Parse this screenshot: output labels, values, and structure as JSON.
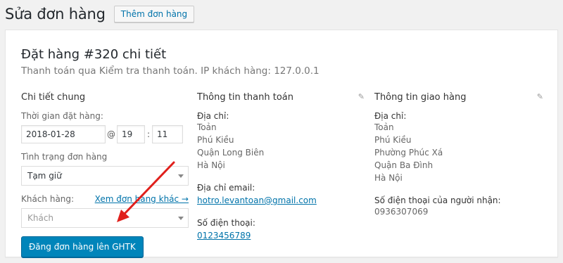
{
  "header": {
    "title": "Sửa đơn hàng",
    "add_button": "Thêm đơn hàng"
  },
  "order": {
    "title": "Đặt hàng #320 chi tiết",
    "subtitle": "Thanh toán qua Kiểm tra thanh toán. IP khách hàng: 127.0.0.1"
  },
  "general": {
    "heading": "Chi tiết chung",
    "date_label": "Thời gian đặt hàng:",
    "date": "2018-01-28",
    "at": "@",
    "hour": "19",
    "colon": ":",
    "minute": "11",
    "status_label": "Tình trạng đơn hàng",
    "status": "Tạm giữ",
    "customer_label": "Khách hàng:",
    "customer_link": "Xem đơn hàng khác →",
    "customer_placeholder": "Khách",
    "ship_button": "Đăng đơn hàng lên GHTK"
  },
  "billing": {
    "heading": "Thông tin thanh toán",
    "address_label": "Địa chỉ:",
    "address": [
      "Toản",
      "Phú Kiều",
      "Quận Long Biên",
      "Hà Nội"
    ],
    "email_label": "Địa chỉ email:",
    "email": "hotro.levantoan@gmail.com",
    "phone_label": "Số điện thoại:",
    "phone": "0123456789"
  },
  "shipping": {
    "heading": "Thông tin giao hàng",
    "address_label": "Địa chỉ:",
    "address": [
      "Toản",
      "Phú Kiều",
      "Phường Phúc Xá",
      "Quận Ba Đình",
      "Hà Nội"
    ],
    "phone_label": "Số điện thoại của người nhận:",
    "phone": "0936307069"
  },
  "colors": {
    "accent": "#0085ba",
    "link": "#0073aa",
    "arrow": "#e0201c"
  }
}
